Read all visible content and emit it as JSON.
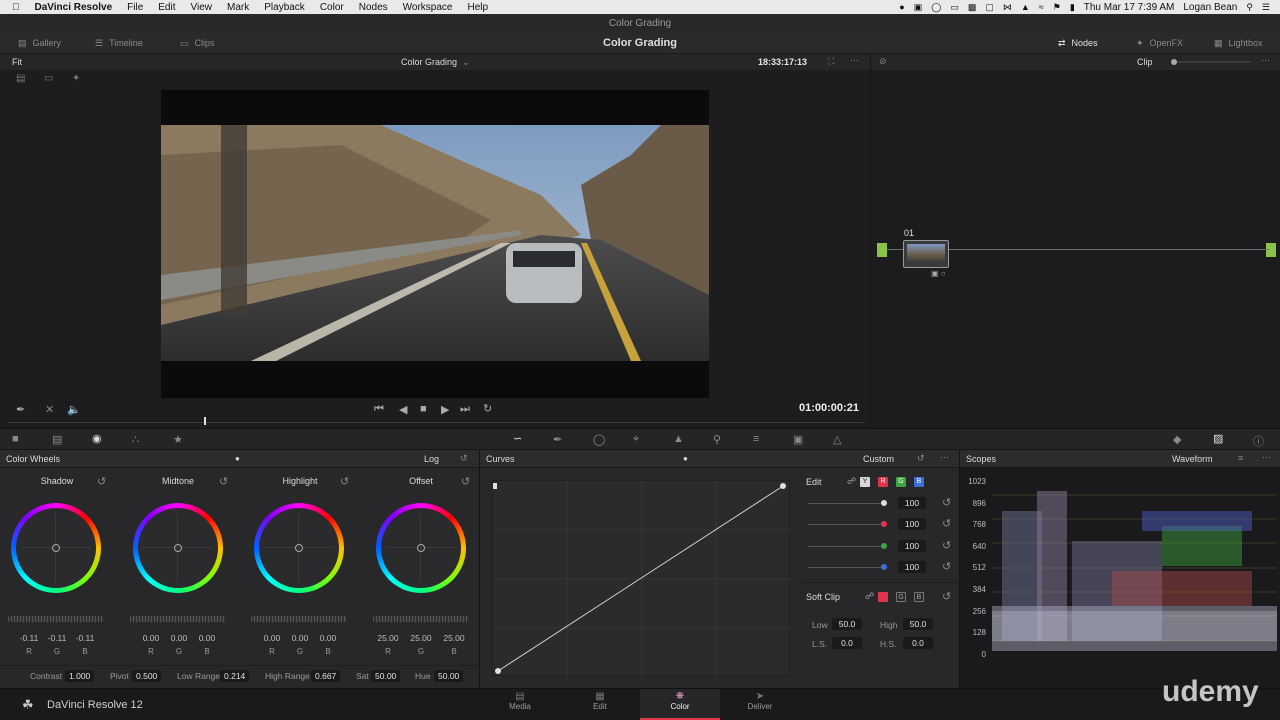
{
  "menubar": {
    "app_name": "DaVinci Resolve",
    "items": [
      "File",
      "Edit",
      "View",
      "Mark",
      "Playback",
      "Color",
      "Nodes",
      "Workspace",
      "Help"
    ],
    "clock": "Thu Mar 17  7:39 AM",
    "user": "Logan Bean"
  },
  "window": {
    "title": "Color Grading"
  },
  "toolbar": {
    "gallery": "Gallery",
    "timeline": "Timeline",
    "clips": "Clips",
    "title": "Color Grading",
    "nodes": "Nodes",
    "openfx": "OpenFX",
    "lightbox": "Lightbox"
  },
  "viewer": {
    "fit": "Fit",
    "title": "Color Grading",
    "timecode_top": "18:33:17:13",
    "timecode": "01:00:00:21",
    "clip_mode": "Clip"
  },
  "node": {
    "label": "01"
  },
  "wheels_panel": {
    "title": "Color Wheels",
    "mode": "Log",
    "wheels": [
      {
        "name": "Shadow",
        "values": [
          "-0.11",
          "-0.11",
          "-0.11"
        ]
      },
      {
        "name": "Midtone",
        "values": [
          "0.00",
          "0.00",
          "0.00"
        ]
      },
      {
        "name": "Highlight",
        "values": [
          "0.00",
          "0.00",
          "0.00"
        ]
      },
      {
        "name": "Offset",
        "values": [
          "25.00",
          "25.00",
          "25.00"
        ]
      }
    ],
    "channels": [
      "R",
      "G",
      "B"
    ],
    "params": {
      "contrast_label": "Contrast",
      "contrast": "1.000",
      "pivot_label": "Pivot",
      "pivot": "0.500",
      "lowrange_label": "Low Range",
      "lowrange": "0.214",
      "highrange_label": "High Range",
      "highrange": "0.667",
      "sat_label": "Sat",
      "sat": "50.00",
      "hue_label": "Hue",
      "hue": "50.00"
    }
  },
  "curves_panel": {
    "title": "Curves",
    "preset": "Custom",
    "edit_label": "Edit",
    "channel_buttons": [
      "Y",
      "R",
      "G",
      "B"
    ],
    "intensity": [
      "100",
      "100",
      "100",
      "100"
    ],
    "softclip_label": "Soft Clip",
    "low_label": "Low",
    "low": "50.0",
    "high_label": "High",
    "high": "50.0",
    "ls_label": "L.S.",
    "ls": "0.0",
    "hs_label": "H.S.",
    "hs": "0.0"
  },
  "scopes_panel": {
    "title": "Scopes",
    "mode": "Waveform",
    "scale": [
      "1023",
      "896",
      "768",
      "640",
      "512",
      "384",
      "256",
      "128",
      "0"
    ]
  },
  "pages": {
    "app_label": "DaVinci Resolve 12",
    "media": "Media",
    "edit": "Edit",
    "color": "Color",
    "deliver": "Deliver",
    "watermark": "udemy"
  },
  "colors": {
    "accent": "#e0344a",
    "node_green": "#8bc34a"
  }
}
